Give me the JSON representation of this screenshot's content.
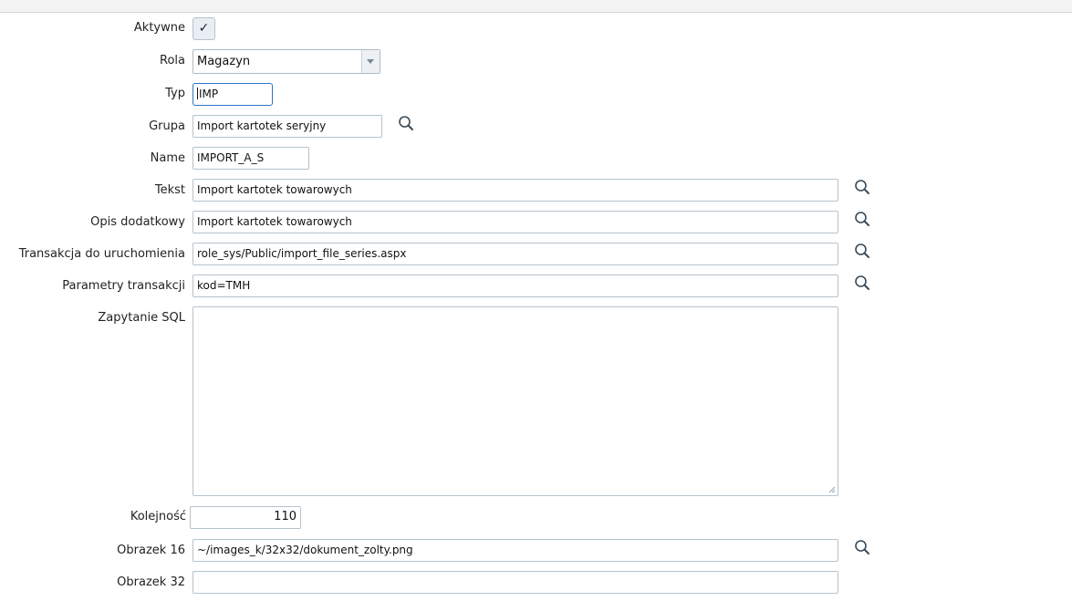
{
  "form": {
    "aktywne": {
      "label": "Aktywne",
      "checked": true,
      "check_glyph": "✓"
    },
    "rola": {
      "label": "Rola",
      "value": "Magazyn"
    },
    "typ": {
      "label": "Typ",
      "value": "IMP"
    },
    "grupa": {
      "label": "Grupa",
      "value": "Import kartotek seryjny"
    },
    "name": {
      "label": "Name",
      "value": "IMPORT_A_S"
    },
    "tekst": {
      "label": "Tekst",
      "value": "Import kartotek towarowych"
    },
    "opis": {
      "label": "Opis dodatkowy",
      "value": "Import kartotek towarowych"
    },
    "transakcja": {
      "label": "Transakcja do uruchomienia",
      "value": "role_sys/Public/import_file_series.aspx"
    },
    "parametry": {
      "label": "Parametry transakcji",
      "value": "kod=TMH"
    },
    "sql": {
      "label": "Zapytanie SQL",
      "value": ""
    },
    "kolejnosc": {
      "label": "Kolejność",
      "value": "110"
    },
    "obrazek16": {
      "label": "Obrazek 16",
      "value": "~/images_k/32x32/dokument_zolty.png"
    },
    "obrazek32": {
      "label": "Obrazek 32",
      "value": ""
    }
  },
  "icons": {
    "lookup": "search-icon"
  },
  "colors": {
    "focus_border": "#2f73c9",
    "field_border": "#b6c3cc",
    "icon": "#3b4a56"
  }
}
